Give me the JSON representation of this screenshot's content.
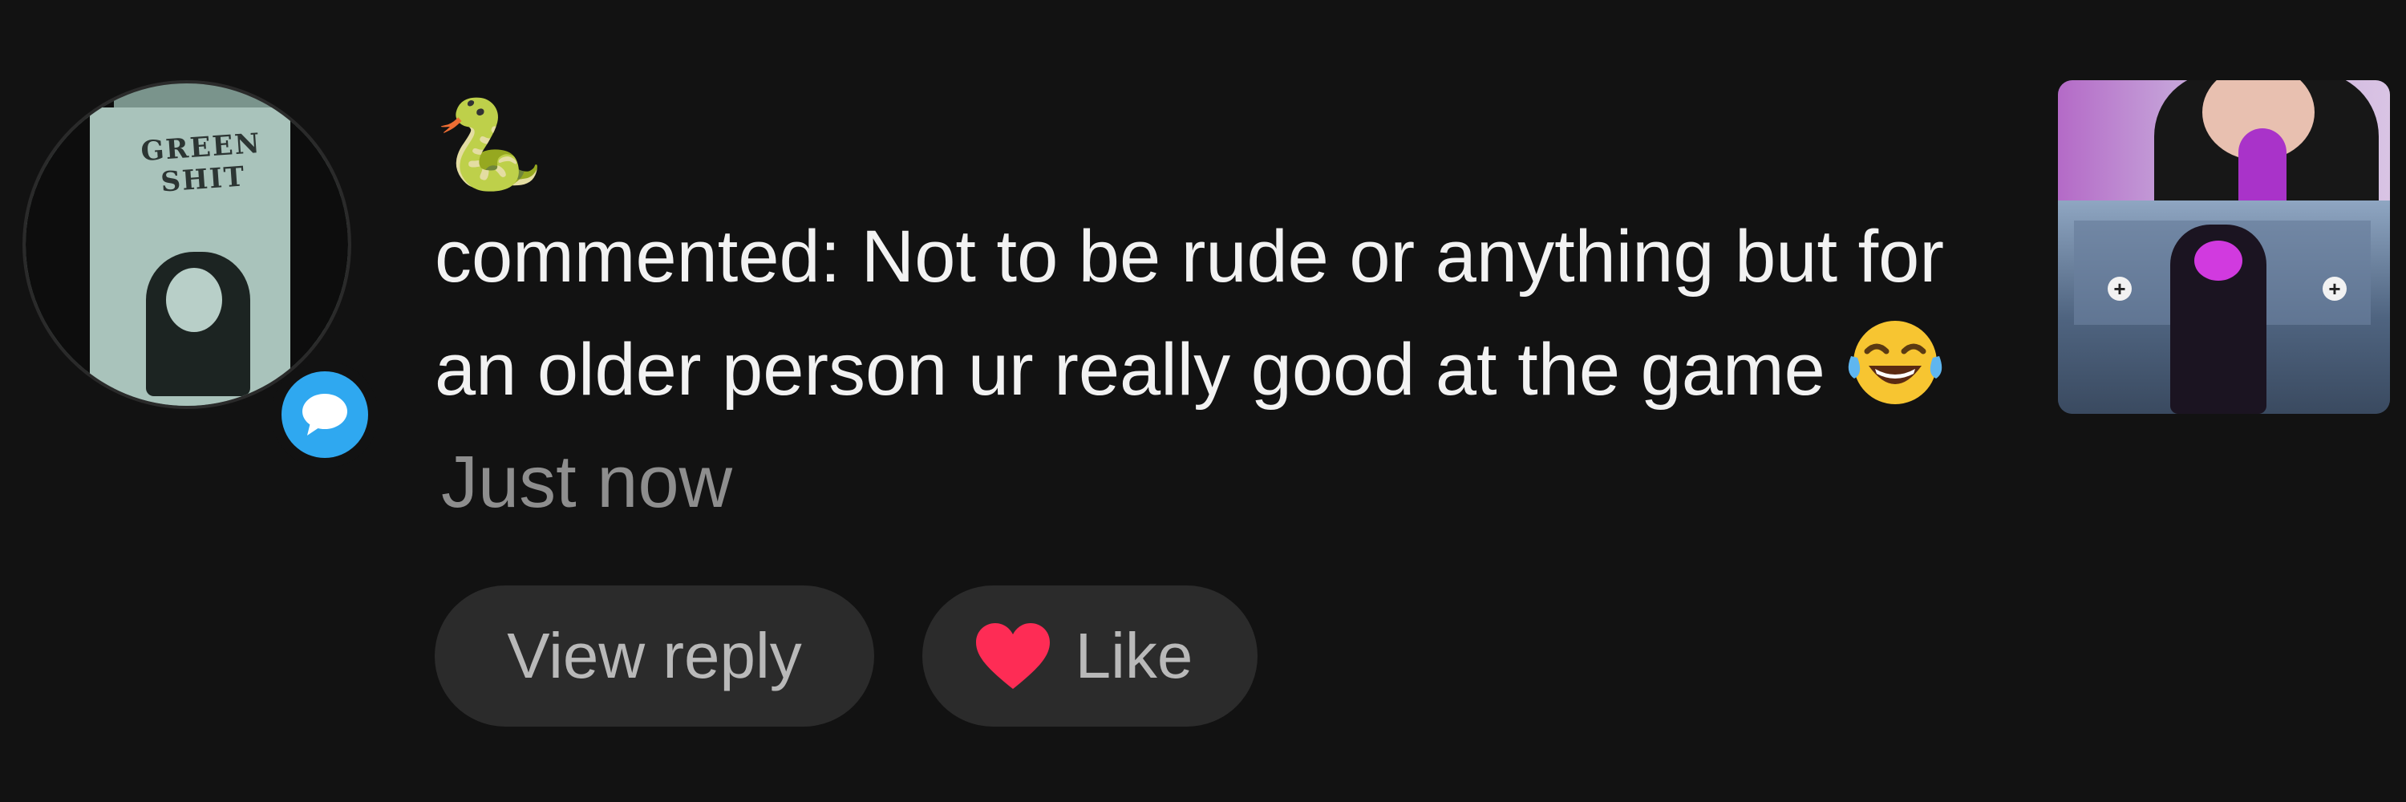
{
  "notification": {
    "username_emoji": "🐍",
    "comment_text": "commented: Not to be rude or anything but for an older person ur really good at the game",
    "inline_emoji": "😂",
    "timestamp": "Just now",
    "badge_icon": "comment-bubble-icon",
    "avatar_poster_text": "GREEN SHIT"
  },
  "actions": {
    "view_reply_label": "View reply",
    "like_label": "Like",
    "like_icon": "heart-icon"
  },
  "colors": {
    "background": "#121212",
    "text": "#f2f2f2",
    "timestamp": "#8e8e8e",
    "pill_bg": "#2b2b2b",
    "pill_text": "#b9b9b9",
    "heart": "#fe2c55",
    "badge": "#2fa8f0"
  }
}
